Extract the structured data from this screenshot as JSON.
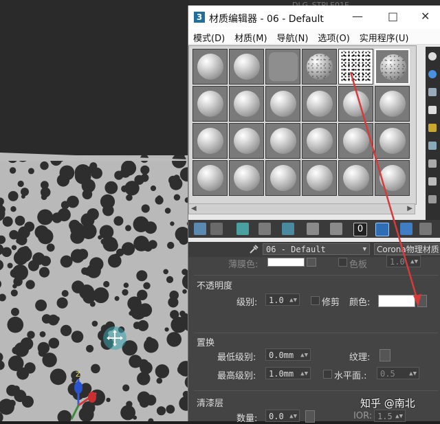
{
  "background_text": "DLG_STPLE01E",
  "window": {
    "icon_letter": "3",
    "title": "材质编辑器 - 06 - Default",
    "minimize": "—",
    "maximize": "□",
    "close": "✕"
  },
  "menu": [
    "模式(D)",
    "材质(M)",
    "导航(N)",
    "选项(O)",
    "实用程序(U)"
  ],
  "toolbar": {
    "num_label": "0"
  },
  "material_name": "06 - Default",
  "material_type": "Corona物理材质",
  "rollout": {
    "hidden_row": {
      "label": "薄膜色:",
      "label2": "色板",
      "value": "1.0"
    },
    "opacity": {
      "title": "不透明度",
      "level_label": "级别:",
      "level_value": "1.0",
      "clip_label": "修剪",
      "color_label": "颜色:"
    },
    "displacement": {
      "title": "置换",
      "min_label": "最低级别:",
      "min_value": "0.0mm",
      "texture_label": "纹理:",
      "max_label": "最高级别:",
      "max_value": "1.0mm",
      "water_label": "水平面.:",
      "water_value": "0.5"
    },
    "clearcoat": {
      "title": "清漆层",
      "amount_label": "数量:",
      "amount_value": "0.0",
      "ior_label": "IOR:",
      "ior_value": "1.5"
    }
  },
  "watermark": "知乎 @南北",
  "colors": {
    "arrow": "#d83a3a",
    "accent_blue": "#2f6db5"
  }
}
